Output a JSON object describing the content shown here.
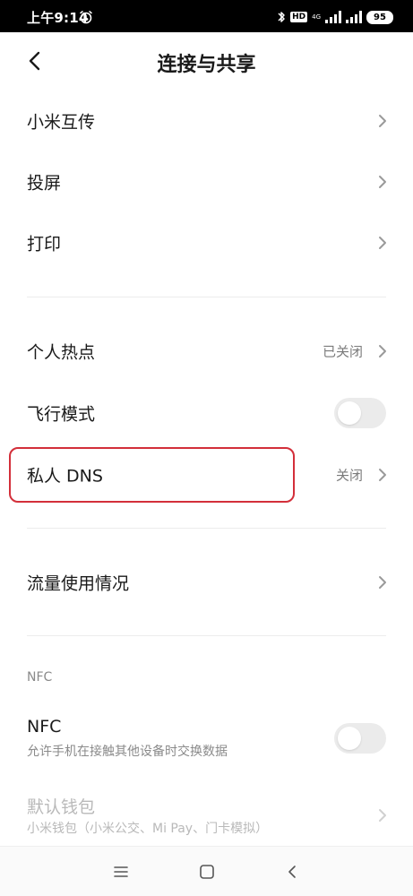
{
  "status_bar": {
    "time": "上午9:14",
    "hd": "HD",
    "net": "4G",
    "battery": "95"
  },
  "header": {
    "title": "连接与共享"
  },
  "group1": [
    {
      "label": "小米互传"
    },
    {
      "label": "投屏"
    },
    {
      "label": "打印"
    }
  ],
  "hotspot": {
    "label": "个人热点",
    "value": "已关闭"
  },
  "airplane": {
    "label": "飞行模式",
    "enabled": false
  },
  "private_dns": {
    "label": "私人 DNS",
    "value": "关闭"
  },
  "data_usage": {
    "label": "流量使用情况"
  },
  "nfc_section": {
    "header": "NFC"
  },
  "nfc": {
    "label": "NFC",
    "subtitle": "允许手机在接触其他设备时交换数据",
    "enabled": false
  },
  "wallet": {
    "label": "默认钱包",
    "subtitle": "小米钱包（小米公交、Mi Pay、门卡模拟）"
  },
  "colors": {
    "highlight": "#d32f3a",
    "toggle_off": "#ebebeb",
    "secondary_text": "#7a7a7a"
  }
}
